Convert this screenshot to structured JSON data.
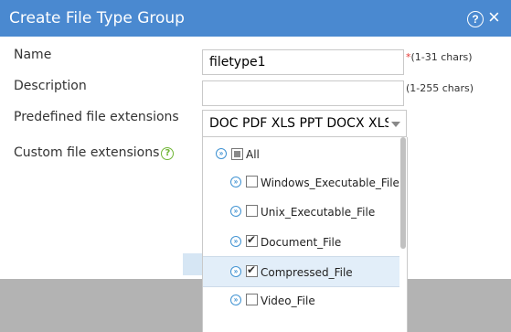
{
  "dialog": {
    "title": "Create File Type Group",
    "help_icon": "?",
    "close_icon": "×"
  },
  "form": {
    "name_label": "Name",
    "name_value": "filetype1",
    "name_required": "*",
    "name_hint": "(1-31 chars)",
    "description_label": "Description",
    "description_value": "",
    "description_hint": "(1-255 chars)",
    "predefined_label": "Predefined file extensions",
    "predefined_value": "DOC PDF XLS PPT DOCX XLSX",
    "custom_label": "Custom file extensions",
    "custom_help": "?"
  },
  "tree": {
    "items": [
      {
        "label": "All",
        "checked": "partial"
      },
      {
        "label": "Windows_Executable_File",
        "checked": "false"
      },
      {
        "label": "Unix_Executable_File",
        "checked": "false"
      },
      {
        "label": "Document_File",
        "checked": "true"
      },
      {
        "label": "Compressed_File",
        "checked": "true",
        "selected": true
      },
      {
        "label": "Video_File",
        "checked": "false"
      }
    ]
  },
  "colors": {
    "titlebar": "#4a89d0",
    "expander": "#3f92d2",
    "help_green": "#6fb535",
    "required": "#e53935"
  }
}
